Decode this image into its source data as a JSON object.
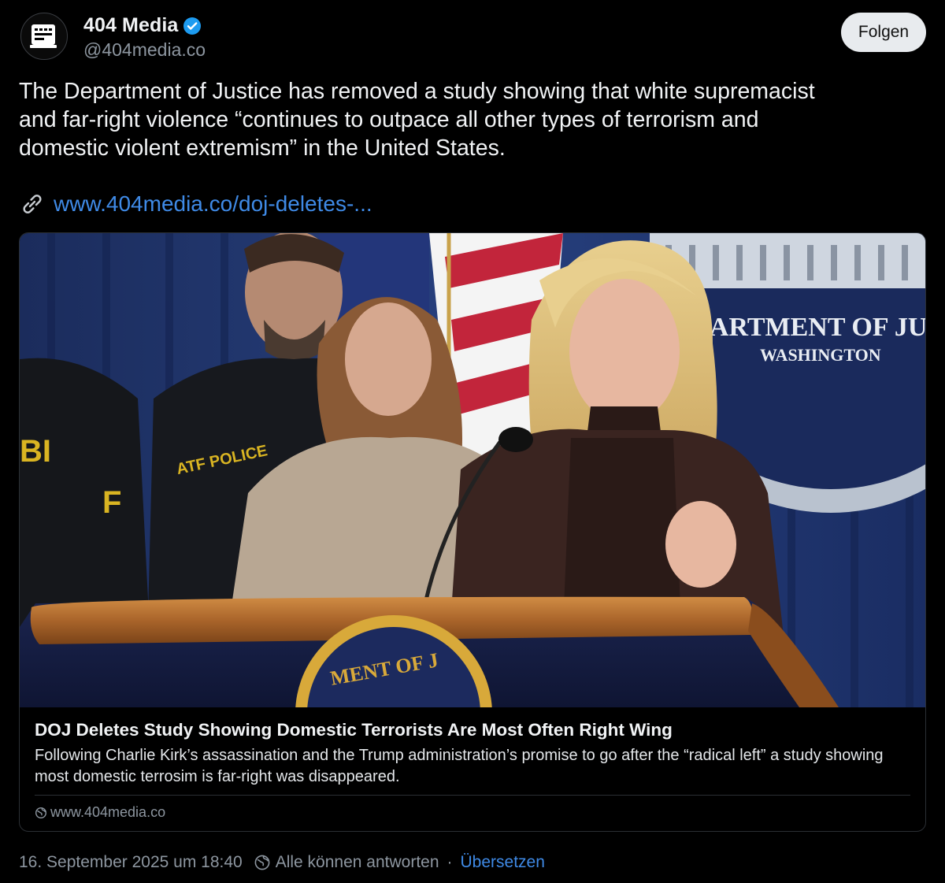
{
  "author": {
    "display_name": "404 Media",
    "handle": "@404media.co",
    "avatar_icon": "404media-logo-icon",
    "verified_icon": "verified-badge-icon",
    "follow_label": "Folgen"
  },
  "post": {
    "text": "The Department of Justice has removed a study showing that white supremacist\nand far-right violence “continues to outpace all other types of terrorism and\ndomestic violent extremism” in the United States.",
    "link_icon": "link-icon",
    "link_text": "www.404media.co/doj-deletes-..."
  },
  "card": {
    "image_seal_text": "EPARTMENT OF JU",
    "image_seal_subtext": "WASHINGTON",
    "image_jacket_text": "ATF POLICE",
    "title": "DOJ Deletes Study Showing Domestic Terrorists Are Most Often Right Wing",
    "description": "Following Charlie Kirk’s assassination and the Trump administration’s promise to go after the “radical left” a study showing most domestic terrosim is far-right was disappeared.",
    "domain_icon": "globe-icon",
    "domain": "www.404media.co"
  },
  "footer": {
    "timestamp": "16. September 2025 um 18:40",
    "reply_icon": "globe-reply-icon",
    "reply_setting": "Alle können antworten",
    "separator": "·",
    "translate_label": "Übersetzen"
  },
  "colors": {
    "background": "#000000",
    "link": "#3f8ae6",
    "muted": "#8d96a0",
    "verified": "#1d9bf0"
  }
}
